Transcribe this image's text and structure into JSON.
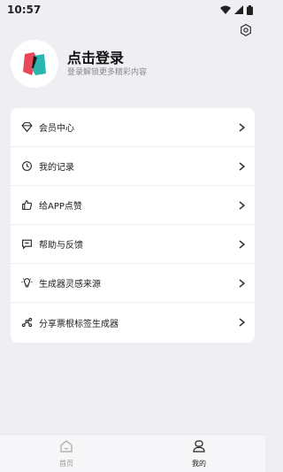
{
  "status_bar": {
    "time": "10:57"
  },
  "settings": {
    "icon": "settings-icon"
  },
  "profile": {
    "title": "点击登录",
    "subtitle": "登录解锁更多精彩内容",
    "accent_red": "#e8485a",
    "accent_teal": "#2bb6b0"
  },
  "menu": {
    "items": [
      {
        "label": "会员中心",
        "icon": "diamond-icon"
      },
      {
        "label": "我的记录",
        "icon": "clock-icon"
      },
      {
        "label": "给APP点赞",
        "icon": "thumbs-up-icon"
      },
      {
        "label": "帮助与反馈",
        "icon": "feedback-icon"
      },
      {
        "label": "生成器灵感来源",
        "icon": "lightbulb-icon"
      },
      {
        "label": "分享票根标签生成器",
        "icon": "share-icon"
      }
    ]
  },
  "bottom_nav": {
    "home_label": "首页",
    "mine_label": "我的"
  }
}
